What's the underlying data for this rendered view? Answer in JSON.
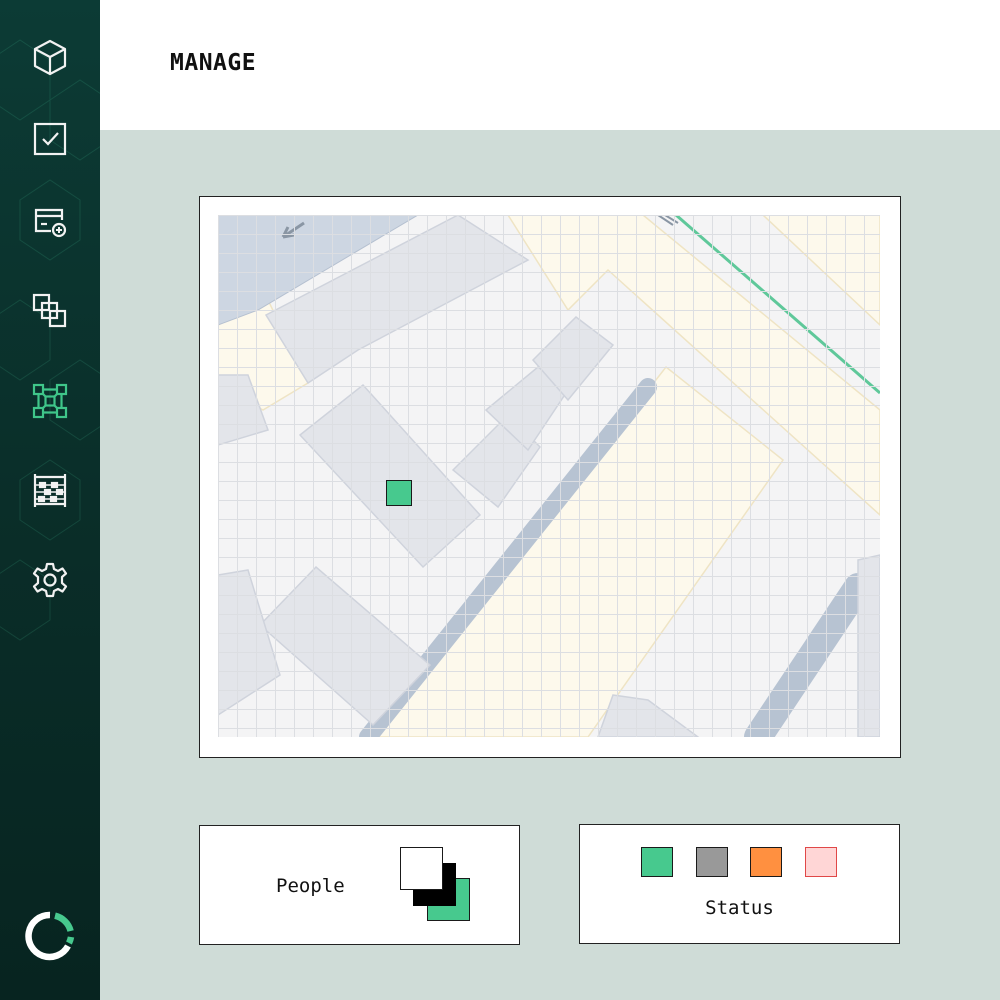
{
  "header": {
    "title": "MANAGE"
  },
  "sidebar": {
    "items": [
      {
        "icon": "cube-icon",
        "active": false
      },
      {
        "icon": "checkbox-icon",
        "active": false
      },
      {
        "icon": "card-add-icon",
        "active": false
      },
      {
        "icon": "layers-icon",
        "active": false
      },
      {
        "icon": "network-grid-icon",
        "active": true
      },
      {
        "icon": "abacus-icon",
        "active": false
      },
      {
        "icon": "gear-icon",
        "active": false
      }
    ],
    "brand_icon": "loader-ring-logo"
  },
  "colors": {
    "sidebar_bg": "#0c3b35",
    "accent": "#47c98e",
    "page_bg": "#cfdcd7"
  },
  "legend": {
    "people_label": "People",
    "status_label": "Status",
    "status_colors": [
      {
        "name": "green",
        "fill": "#47c98e",
        "border": "#1a1a1a"
      },
      {
        "name": "gray",
        "fill": "#999999",
        "border": "#1a1a1a"
      },
      {
        "name": "orange",
        "fill": "#ff9040",
        "border": "#1a1a1a"
      },
      {
        "name": "pink",
        "fill": "#ffd6d6",
        "border": "#e04848"
      }
    ]
  },
  "map": {
    "marker": {
      "status": "green"
    }
  }
}
